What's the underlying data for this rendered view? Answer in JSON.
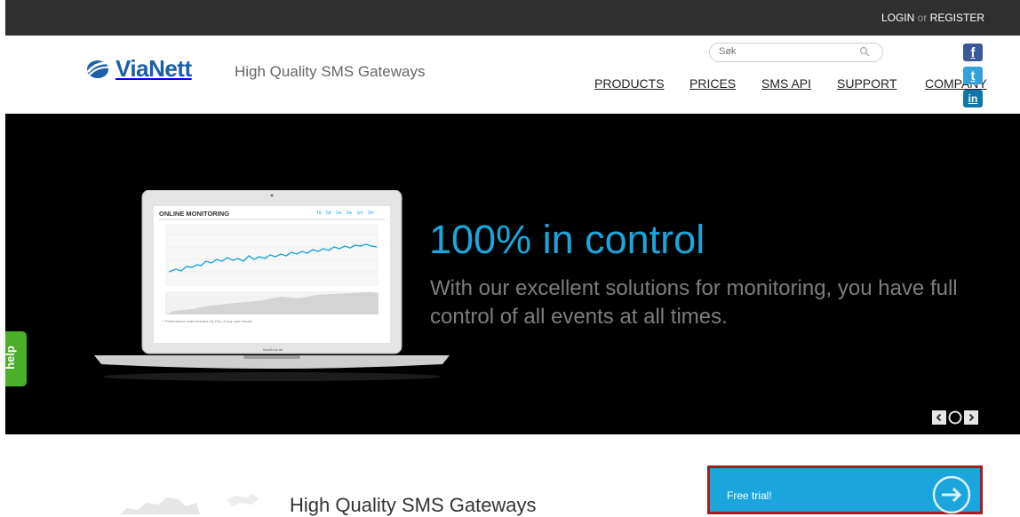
{
  "topbar": {
    "login": "LOGIN",
    "or": "or",
    "register": "REGISTER"
  },
  "header": {
    "logo": {
      "part1": "Via",
      "part2": "Nett"
    },
    "tagline": "High Quality SMS Gateways",
    "search": {
      "placeholder": "Søk"
    },
    "nav": [
      "PRODUCTS",
      "PRICES",
      "SMS API",
      "SUPPORT",
      "COMPANY"
    ],
    "social": [
      {
        "name": "facebook",
        "glyph": "f",
        "color": "#3b5998"
      },
      {
        "name": "twitter",
        "glyph": "t",
        "color": "#33a1dc"
      },
      {
        "name": "linkedin",
        "glyph": "in",
        "color": "#0e76a8"
      }
    ]
  },
  "hero": {
    "title": "100% in control",
    "text": "With our excellent solutions for monitoring, you have full control of all events at all times.",
    "screen": {
      "title": "ONLINE MONITORING",
      "ranges": [
        "1d",
        "5d",
        "1w",
        "2w",
        "1m",
        "3m"
      ],
      "footnote": "* Performance chart includes the P&L of any open trades",
      "brand": "MacBook Air"
    }
  },
  "help": {
    "label": "help"
  },
  "lower": {
    "title": "High Quality SMS Gateways",
    "cta": "Free trial!"
  },
  "colors": {
    "accent": "#1aa6dc",
    "topbar": "#2f2f2f",
    "help": "#4caf2a",
    "cta_border": "#a51d23"
  }
}
